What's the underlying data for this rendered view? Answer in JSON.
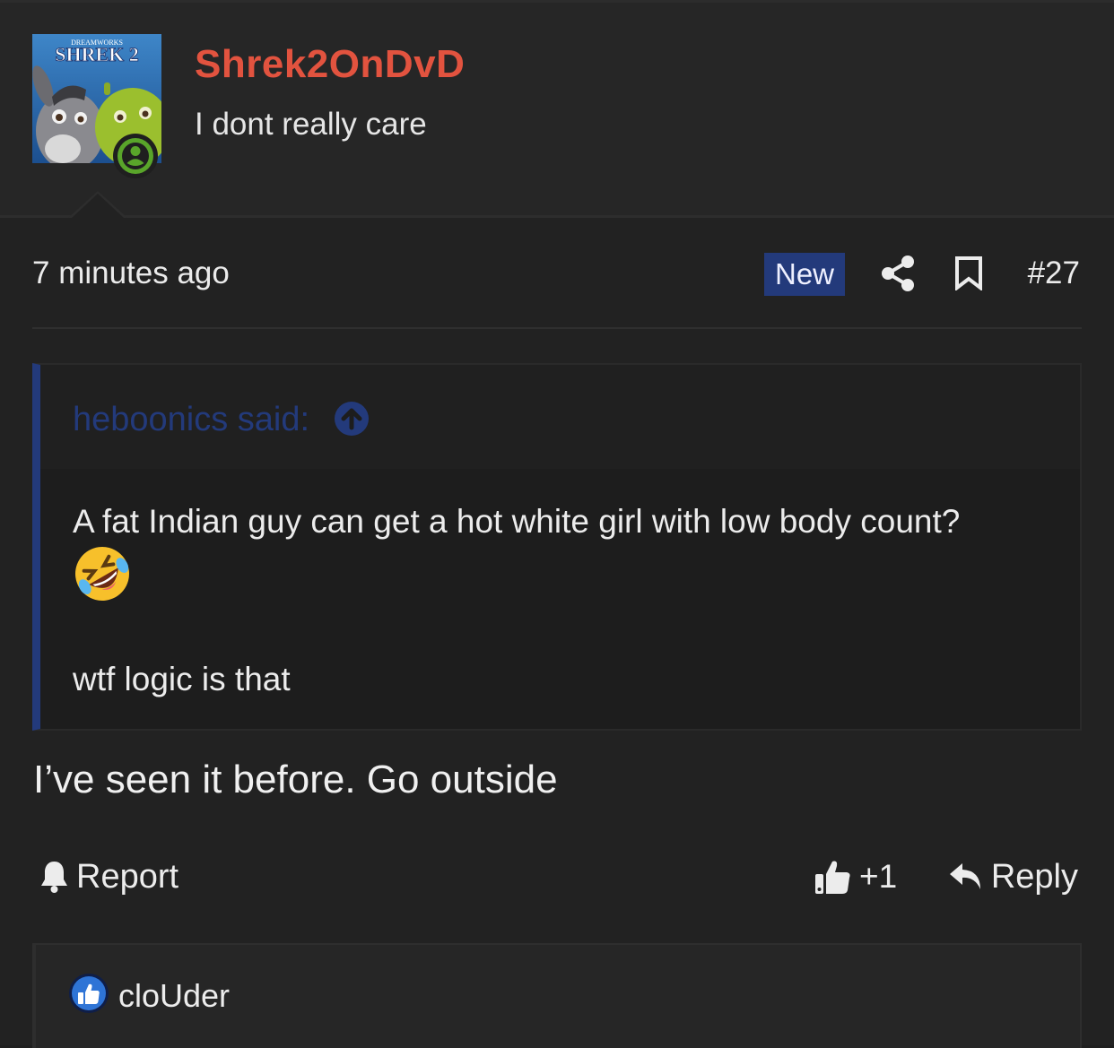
{
  "author": {
    "username": "Shrek2OnDvD",
    "user_title": "I dont really care",
    "avatar_text": "SHREK 2",
    "avatar_small_text": "DREAMWORKS",
    "online": true
  },
  "meta": {
    "timestamp": "7 minutes ago",
    "new_badge": "New",
    "post_number": "#27"
  },
  "quote": {
    "author_label": "heboonics said:",
    "line1": "A fat Indian guy can get a hot white girl with low body count?",
    "emoji": "rolling-on-floor-laughing-emoji",
    "line2": "wtf logic is that"
  },
  "body": {
    "text": "I’ve seen it before. Go outside"
  },
  "actions": {
    "report_label": "Report",
    "like_count": "+1",
    "reply_label": "Reply"
  },
  "reactions": {
    "icon": "thumbs-up-icon",
    "users": "cloUder"
  },
  "colors": {
    "username": "#e2533f",
    "accent_blue": "#233a7b",
    "online_green": "#59a52a",
    "background": "#222222"
  }
}
